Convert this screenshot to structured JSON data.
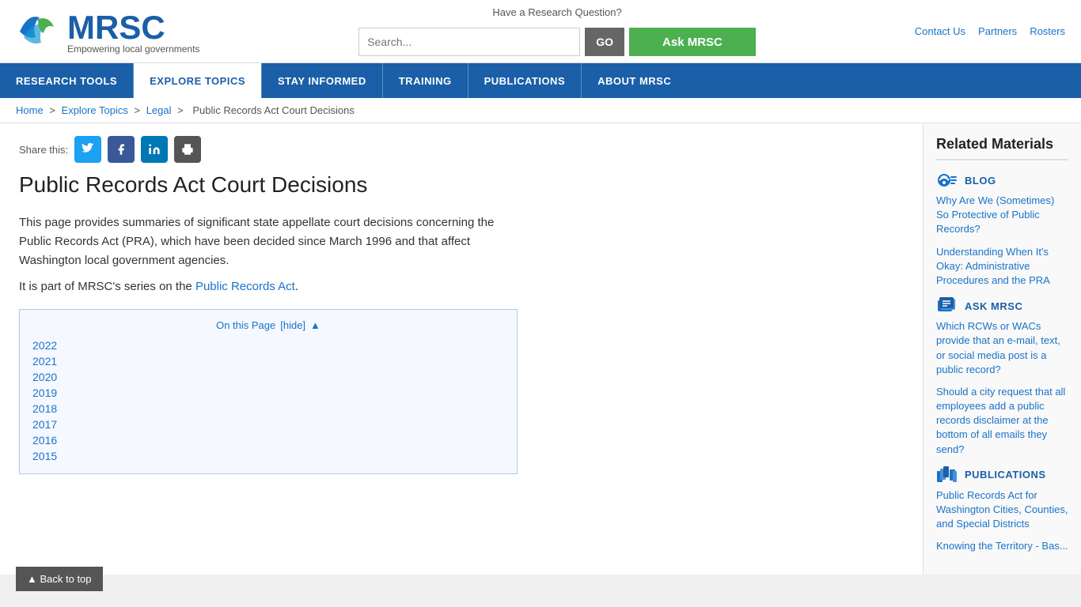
{
  "topbar": {
    "links": [
      {
        "label": "Contact Us",
        "href": "#"
      },
      {
        "label": "Partners",
        "href": "#"
      },
      {
        "label": "Rosters",
        "href": "#"
      }
    ],
    "research_question": "Have a Research Question?",
    "search_placeholder": "Search...",
    "go_label": "GO",
    "ask_label": "Ask MRSC"
  },
  "logo": {
    "title": "MRSC",
    "subtitle": "Empowering local governments"
  },
  "nav": {
    "items": [
      {
        "label": "RESEARCH TOOLS",
        "active": false
      },
      {
        "label": "EXPLORE TOPICS",
        "active": true
      },
      {
        "label": "STAY INFORMED",
        "active": false
      },
      {
        "label": "TRAINING",
        "active": false
      },
      {
        "label": "PUBLICATIONS",
        "active": false
      },
      {
        "label": "ABOUT MRSC",
        "active": false
      }
    ]
  },
  "breadcrumb": {
    "items": [
      {
        "label": "Home",
        "href": "#"
      },
      {
        "label": "Explore Topics",
        "href": "#"
      },
      {
        "label": "Legal",
        "href": "#"
      },
      {
        "label": "Public Records Act Court Decisions",
        "href": null
      }
    ]
  },
  "share": {
    "label": "Share this:"
  },
  "page": {
    "title": "Public Records Act Court Decisions",
    "body1": "This page provides summaries of significant state appellate court decisions concerning the Public Records Act (PRA), which have been decided since March 1996 and that affect Washington local government agencies.",
    "body2": "It is part of MRSC's series on the",
    "body2_link": "Public Records Act",
    "body2_end": ".",
    "toc_header": "On this Page",
    "toc_hide": "[hide]",
    "toc_years": [
      "2022",
      "2021",
      "2020",
      "2019",
      "2018",
      "2017",
      "2016",
      "2015"
    ]
  },
  "back_to_top": "▲ Back to top",
  "sidebar": {
    "title": "Related Materials",
    "sections": [
      {
        "type": "blog",
        "label": "BLOG",
        "links": [
          "Why Are We (Sometimes) So Protective of Public Records?",
          "Understanding When It's Okay: Administrative Procedures and the PRA"
        ]
      },
      {
        "type": "ask",
        "label": "ASK MRSC",
        "links": [
          "Which RCWs or WACs provide that an e-mail, text, or social media post is a public record?",
          "Should a city request that all employees add a public records disclaimer at the bottom of all emails they send?"
        ]
      },
      {
        "type": "publications",
        "label": "PUBLICATIONS",
        "links": [
          "Public Records Act for Washington Cities, Counties, and Special Districts",
          "Knowing the Territory - Bas..."
        ]
      }
    ]
  }
}
